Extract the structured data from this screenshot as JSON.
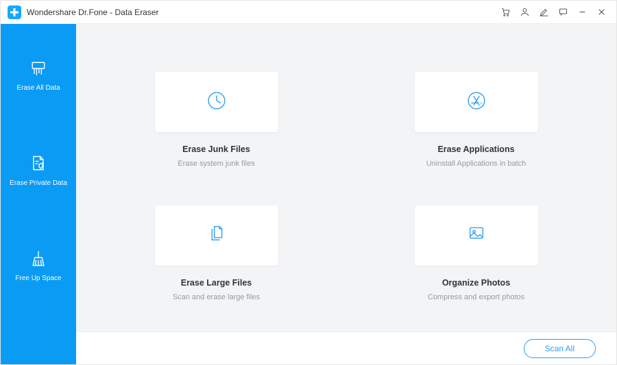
{
  "title": "Wondershare Dr.Fone - Data Eraser",
  "sidebar": {
    "items": [
      {
        "label": "Erase All Data"
      },
      {
        "label": "Erase Private Data"
      },
      {
        "label": "Free Up Space"
      }
    ]
  },
  "grid": {
    "cards": [
      {
        "title": "Erase Junk Files",
        "subtitle": "Erase system junk files"
      },
      {
        "title": "Erase Applications",
        "subtitle": "Uninstall Applications in batch"
      },
      {
        "title": "Erase Large Files",
        "subtitle": "Scan and erase large files"
      },
      {
        "title": "Organize Photos",
        "subtitle": "Compress and export photos"
      }
    ]
  },
  "footer": {
    "scan_label": "Scan All"
  }
}
